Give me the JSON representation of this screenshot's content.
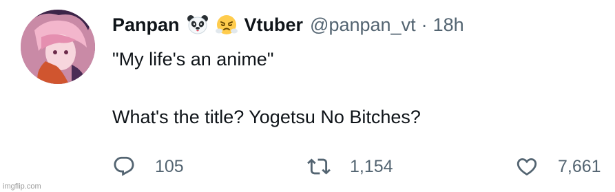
{
  "tweet": {
    "display_name": "Panpan",
    "name_suffix": "Vtuber",
    "handle": "@panpan_vt",
    "separator": "·",
    "time": "18h",
    "text_line1": "\"My life's an anime\"",
    "text_line2": "What's the title? Yogetsu No Bitches?",
    "emojis": [
      "panda-face-emoji",
      "face-with-steam-emoji"
    ]
  },
  "actions": {
    "reply_count": "105",
    "retweet_count": "1,154",
    "like_count": "7,661",
    "icons": [
      "reply-icon",
      "retweet-icon",
      "like-icon"
    ]
  },
  "watermark": "imgflip.com",
  "colors": {
    "text": "#0f1419",
    "secondary": "#536471",
    "background": "#ffffff"
  }
}
